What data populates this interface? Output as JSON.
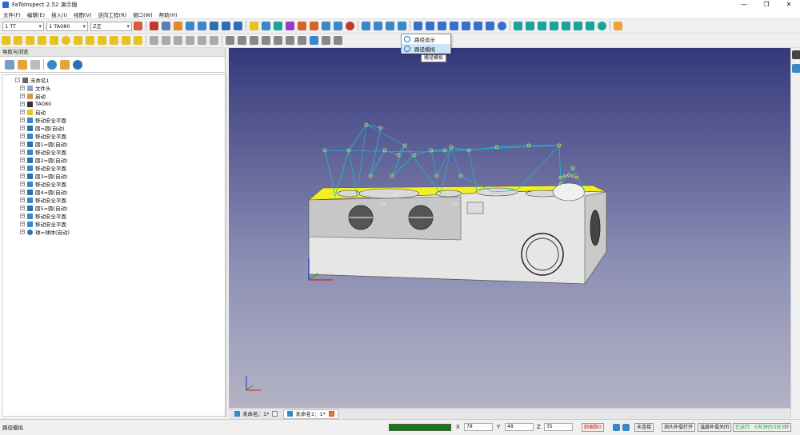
{
  "window": {
    "title": "FaToInspect 2.52 演示版",
    "min": "—",
    "max": "❐",
    "close": "✕"
  },
  "menu": [
    "文件(F)",
    "编辑(E)",
    "插入(I)",
    "视图(V)",
    "逆向工程(R)",
    "窗口(W)",
    "帮助(H)"
  ],
  "toolbar": {
    "combo1": "1 TT",
    "combo2": "1 TA080",
    "combo3": "Z正"
  },
  "panel": {
    "title": "导航与浏览",
    "root": "未命名1",
    "items": [
      "文件头",
      "启动",
      "TA080",
      "启动",
      "移动安全平面",
      "圆=圆(自动)",
      "移动安全平面",
      "圆1=圆(自动)",
      "移动安全平面",
      "圆2=圆(自动)",
      "移动安全平面",
      "圆3=圆(自动)",
      "移动安全平面",
      "圆4=圆(自动)",
      "移动安全平面",
      "圆5=圆(自动)",
      "移动安全平面",
      "移动安全平面",
      "球=球体(自动)"
    ]
  },
  "popup": {
    "item1": "路径显示",
    "item2": "路径模拟",
    "tooltip": "路径模拟"
  },
  "viewport": {
    "labels": [
      "R8",
      "R4",
      "R8",
      "R8",
      "R1"
    ]
  },
  "doc_tabs": [
    "未命名：1*",
    "未命名1：1*"
  ],
  "status": {
    "message": "路径模拟",
    "x_label": "X",
    "x_value": "78",
    "y_label": "Y",
    "y_value": "48",
    "z_label": "Z",
    "z_value": "35",
    "alarm": "跑偏数0",
    "connection": "未连接",
    "probe": "测头补偿打开",
    "temp": "温度补偿关闭",
    "runtime": "已运行：0天3时53分3秒"
  },
  "colors": {
    "viewport_top": "#34387a",
    "part_top": "#f2ef24",
    "path": "#1fb7d0",
    "progress": "#0f7d0f"
  }
}
